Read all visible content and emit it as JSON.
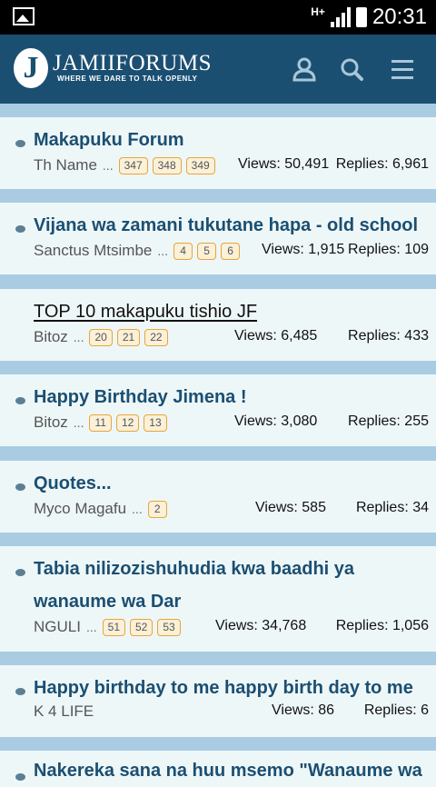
{
  "statusbar": {
    "network": "H+",
    "time": "20:31"
  },
  "header": {
    "logo_letter": "J",
    "logo_name": "JAMIIFORUMS",
    "tagline": "WHERE WE DARE TO TALK OPENLY"
  },
  "threads": [
    {
      "title": "Makapuku Forum",
      "author": "Th Name",
      "ellipsis": "...",
      "pages": [
        "347",
        "348",
        "349"
      ],
      "views": "Views: 50,491",
      "replies": "Replies: 6,961"
    },
    {
      "title": "Vijana wa zamani tukutane hapa - old school",
      "author": "Sanctus Mtsimbe",
      "ellipsis": "...",
      "pages": [
        "4",
        "5",
        "6"
      ],
      "views": "Views: 1,915",
      "replies": "Replies: 109"
    },
    {
      "title": "TOP 10 makapuku tishio JF",
      "author": "Bitoz",
      "ellipsis": "...",
      "pages": [
        "20",
        "21",
        "22"
      ],
      "views": "Views: 6,485",
      "replies": "Replies: 433"
    },
    {
      "title": "Happy Birthday Jimena !",
      "author": "Bitoz",
      "ellipsis": "...",
      "pages": [
        "11",
        "12",
        "13"
      ],
      "views": "Views: 3,080",
      "replies": "Replies: 255"
    },
    {
      "title": "Quotes...",
      "author": "Myco Magafu",
      "ellipsis": "...",
      "pages": [
        "2"
      ],
      "views": "Views: 585",
      "replies": "Replies: 34"
    },
    {
      "title_line1": "Tabia nilizozishuhudia kwa baadhi ya",
      "title_line2": "wanaume wa Dar",
      "author": "NGULI",
      "ellipsis": "...",
      "pages": [
        "51",
        "52",
        "53"
      ],
      "views": "Views: 34,768",
      "replies": "Replies: 1,056"
    },
    {
      "title": "Happy birthday to me happy birth day to me",
      "author": "K 4 LIFE",
      "views": "Views: 86",
      "replies": "Replies: 6"
    },
    {
      "title": "Nakereka sana na huu msemo \"Wanaume wa"
    }
  ]
}
